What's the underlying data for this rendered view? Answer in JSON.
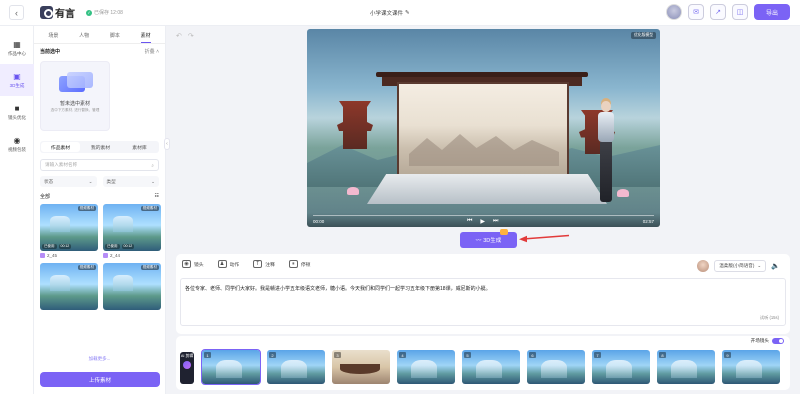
{
  "topbar": {
    "logo_text": "有言",
    "saved_text": "已保存 12:08",
    "doc_title": "小学课文课件",
    "export_label": "导出"
  },
  "rail": [
    {
      "label": "作品中心",
      "icon": "grid-icon"
    },
    {
      "label": "3D生成",
      "icon": "3d-generate-icon",
      "active": true
    },
    {
      "label": "镜头优化",
      "icon": "camera-icon"
    },
    {
      "label": "视频包装",
      "icon": "film-icon"
    }
  ],
  "panel": {
    "tabs": [
      "场景",
      "人物",
      "脚本",
      "素材"
    ],
    "active_tab": "素材",
    "selected_title": "当前选中",
    "collapse_label": "折叠",
    "selected_card_title": "暂未选中素材",
    "selected_card_hint": "选中下方素材, 进行替换、管理",
    "lib_tabs": [
      "作品素材",
      "我的素材",
      "素材库"
    ],
    "search_placeholder": "请输入素材名称",
    "filter_status": "状态",
    "filter_type": "类型",
    "all_label": "全部",
    "thumbs": [
      {
        "name": "2_45",
        "badge": "视频素材",
        "tags": [
          "已使用",
          "00:12"
        ]
      },
      {
        "name": "2_44",
        "badge": "视频素材",
        "tags": [
          "已使用",
          "00:12"
        ]
      },
      {
        "name": "",
        "badge": "视频素材",
        "tags": []
      },
      {
        "name": "",
        "badge": "视频素材",
        "tags": []
      }
    ],
    "load_more": "加载更多...",
    "upload_label": "上传素材"
  },
  "preview": {
    "tag": "优化版模型",
    "time_current": "00:00",
    "time_total": "02:57"
  },
  "generate": {
    "label": "3D生成"
  },
  "editor": {
    "tools": [
      "镜头",
      "动作",
      "注释",
      "停顿"
    ],
    "voice_label": "温柔版(小简语音)",
    "text": "各位专家、老师、同学们大家好。我是赣进小学五年级语文老师，糖小语。今天我们和同学们一起学习五年级下册第18课，威尼斯的小艇。",
    "char_count": "试听 (15s)"
  },
  "strip": {
    "toggle_label": "开场镜头",
    "ai_label": "AI 剪辑",
    "scenes": [
      "1",
      "2",
      "3",
      "4",
      "5",
      "6",
      "7",
      "8",
      "9"
    ]
  }
}
